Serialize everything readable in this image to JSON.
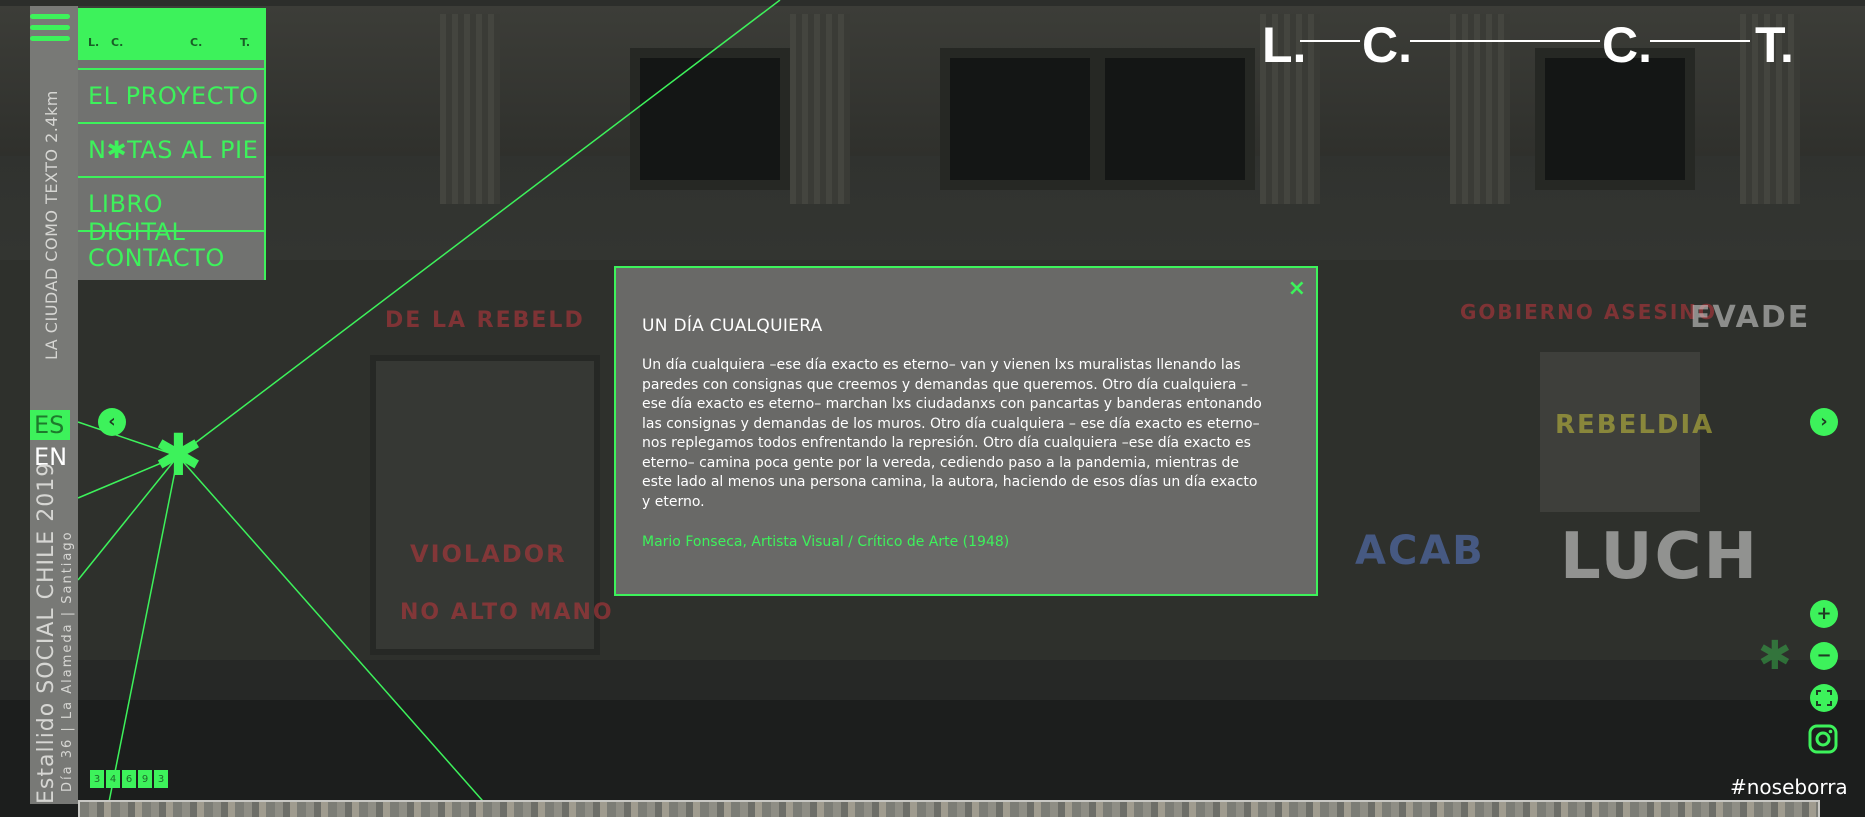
{
  "menu": {
    "items": [
      "EL PROYECTO",
      "N✱TAS AL PIE",
      "LIBRO DIGITAL",
      "CONTACTO"
    ],
    "logo_letters": [
      "L.",
      "C.",
      "C.",
      "T."
    ]
  },
  "sidebar": {
    "title": "LA CIUDAD COMO TEXTO 2.4km",
    "event": "Estallido SOCIAL CHILE 2019",
    "location": "Día 36 | La Alameda | Santiago",
    "languages": [
      "ES",
      "EN"
    ],
    "active_language": "ES"
  },
  "logo": {
    "letters": [
      "L.",
      "C.",
      "C.",
      "T."
    ]
  },
  "modal": {
    "close": "×",
    "title": "UN DÍA CUALQUIERA",
    "body": "Un día cualquiera –ese día exacto es eterno– van y vienen lxs muralistas llenando las paredes con consignas que creemos y demandas que queremos. Otro día cualquiera –ese día exacto es eterno– marchan lxs ciudadanxs con pancartas y banderas entonando las consignas y demandas de los muros. Otro día cualquiera – ese día exacto es eterno– nos replegamos todos enfrentando la represión. Otro día cualquiera –ese día exacto es eterno– camina poca gente por la vereda, cediendo paso a la pandemia, mientras de este lado al menos una persona camina, la autora, haciendo de esos días un día exacto y eterno.",
    "author": "Mario Fonseca, Artista Visual / Crítico de Arte (1948)"
  },
  "controls": {
    "zoom_in": "+",
    "zoom_out": "−",
    "fullscreen_icon": "fullscreen-icon",
    "instagram_icon": "instagram-icon",
    "prev_icon": "chevron-left-icon",
    "next_icon": "chevron-right-icon"
  },
  "hashtag": "#noseborra",
  "thumbnails": [
    "3",
    "4",
    "6",
    "9",
    "3"
  ],
  "graffiti": [
    "DE LA REBELD",
    "GOBIERNO ASESINO",
    "EVADE",
    "REBELDIA",
    "LUCH",
    "ACAB",
    "NO ALTO MANO",
    "VIOLADOR"
  ],
  "colors": {
    "accent": "#3df25b",
    "panel": "#717270"
  }
}
